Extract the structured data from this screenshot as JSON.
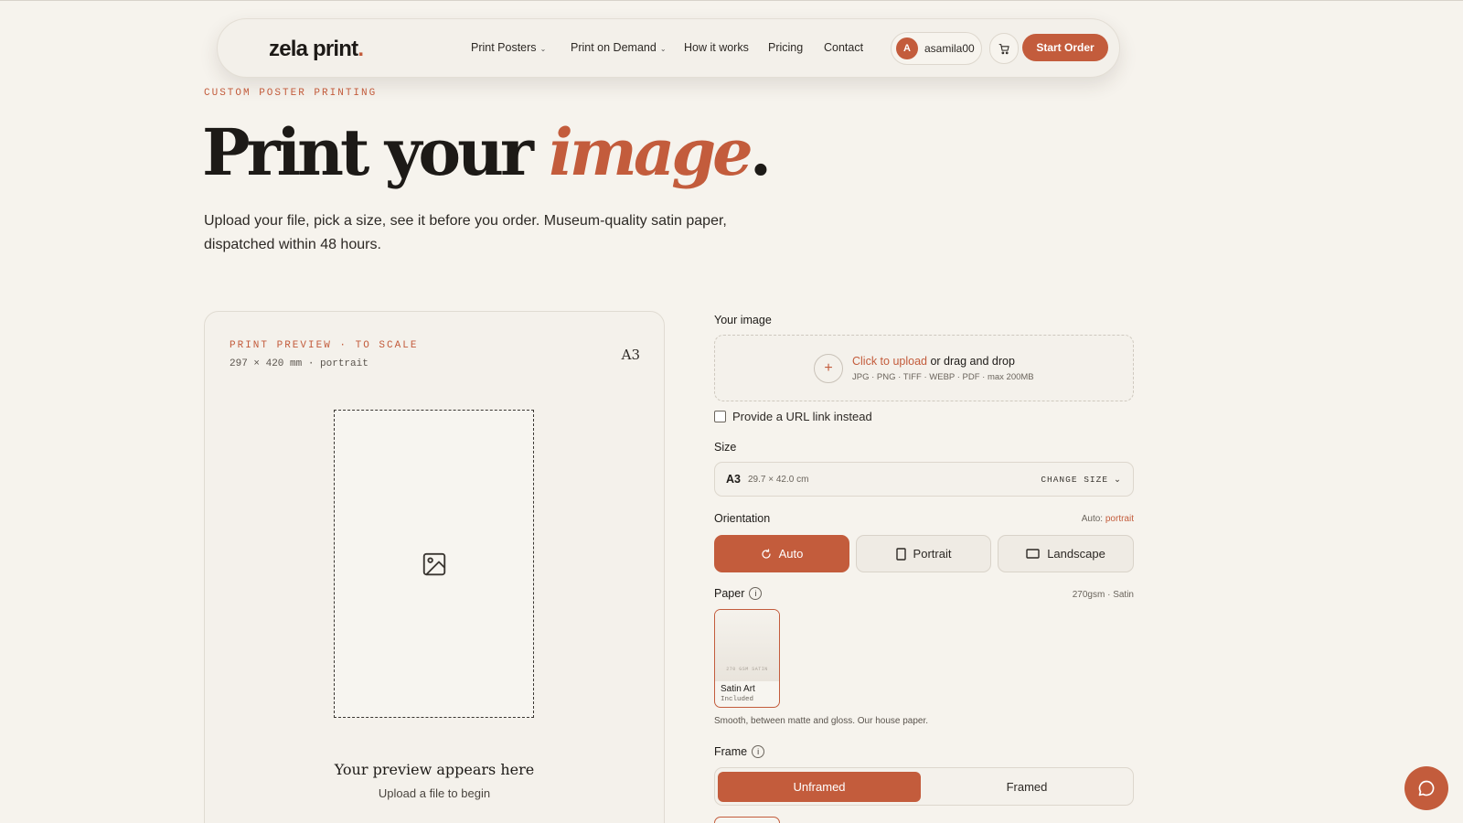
{
  "nav": {
    "logo_text": "zela print",
    "logo_dot": ".",
    "links": [
      {
        "label": "Print Posters",
        "has_dropdown": true
      },
      {
        "label": "Print on Demand",
        "has_dropdown": true
      },
      {
        "label": "How it works",
        "has_dropdown": false
      },
      {
        "label": "Pricing",
        "has_dropdown": false
      },
      {
        "label": "Contact",
        "has_dropdown": false
      }
    ],
    "dropdown_glyph": "⌄",
    "user": {
      "initial": "A",
      "name": "asamila00"
    },
    "cta": "Start Order"
  },
  "hero": {
    "eyebrow": "CUSTOM POSTER PRINTING",
    "title_main": "Print your ",
    "title_accent": "image",
    "title_end": ".",
    "subtitle": "Upload your file, pick a size, see it before you order. Museum-quality satin paper, dispatched within 48 hours."
  },
  "preview": {
    "label": "PRINT PREVIEW · TO SCALE",
    "dims": "297 × 420 mm · portrait",
    "size": "A3",
    "placeholder_title": "Your preview appears here",
    "placeholder_hint": "Upload a file to begin"
  },
  "form": {
    "image_label": "Your image",
    "upload_link": "Click to upload",
    "upload_rest": " or drag and drop",
    "upload_formats": "JPG · PNG · TIFF · WEBP · PDF · max 200MB",
    "plus": "+",
    "url_option": "Provide a URL link instead",
    "size_label": "Size",
    "size_code": "A3",
    "size_dims": "29.7 × 42.0 cm",
    "change_size": "CHANGE SIZE",
    "orientation_label": "Orientation",
    "orientation_auto_prefix": "Auto: ",
    "orientation_auto_value": "portrait",
    "orientation_options": [
      "Auto",
      "Portrait",
      "Landscape"
    ],
    "orientation_selected": "Auto",
    "paper_label": "Paper",
    "paper_spec": "270gsm · Satin",
    "paper_card_tag": "270 GSM SATIN",
    "paper_name": "Satin Art",
    "paper_included": "Included",
    "paper_desc": "Smooth, between matte and gloss. Our house paper.",
    "frame_label": "Frame",
    "frame_options": [
      "Unframed",
      "Framed"
    ],
    "frame_selected": "Unframed",
    "info_glyph": "i"
  },
  "colors": {
    "accent": "#c35c3c",
    "background": "#f6f3ed",
    "text": "#1d1a17"
  },
  "icons": [
    "cart-icon",
    "image-placeholder-icon",
    "refresh-icon",
    "portrait-icon",
    "landscape-icon",
    "info-icon",
    "chat-icon",
    "chevron-down-icon"
  ]
}
